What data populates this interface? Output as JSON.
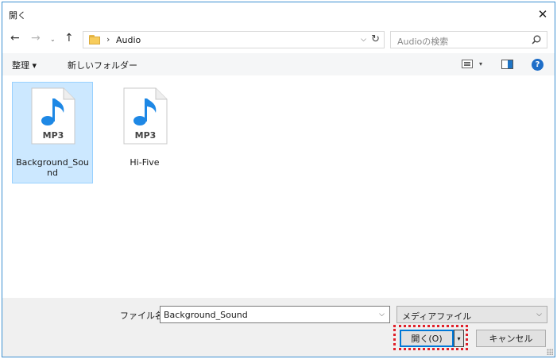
{
  "window": {
    "title": "開く",
    "close_glyph": "✕"
  },
  "nav": {
    "back_glyph": "←",
    "forward_glyph": "→",
    "history_glyph": "⌄",
    "up_glyph": "↑",
    "path_separator": "›",
    "current_folder": "Audio",
    "dropdown_glyph": "⌵",
    "refresh_glyph": "↻"
  },
  "search": {
    "placeholder": "Audioの検索"
  },
  "commands": {
    "organize": "整理 ▾",
    "new_folder": "新しいフォルダー",
    "view_drop": "▾",
    "help": "?"
  },
  "files": [
    {
      "name": "Background_Sound",
      "type_label": "MP3",
      "selected": true
    },
    {
      "name": "Hi-Five",
      "type_label": "MP3",
      "selected": false
    }
  ],
  "footer": {
    "filename_label": "ファイル名(N):",
    "filename_value": "Background_Sound",
    "filter_value": "メディアファイル",
    "dropdown_glyph": "⌵",
    "open_label": "開く(O)",
    "split_glyph": "▾",
    "cancel_label": "キャンセル"
  },
  "colors": {
    "accent": "#0078d7",
    "selection": "#cce8ff",
    "highlight": "#e0202a",
    "music_note": "#1e88e5"
  }
}
